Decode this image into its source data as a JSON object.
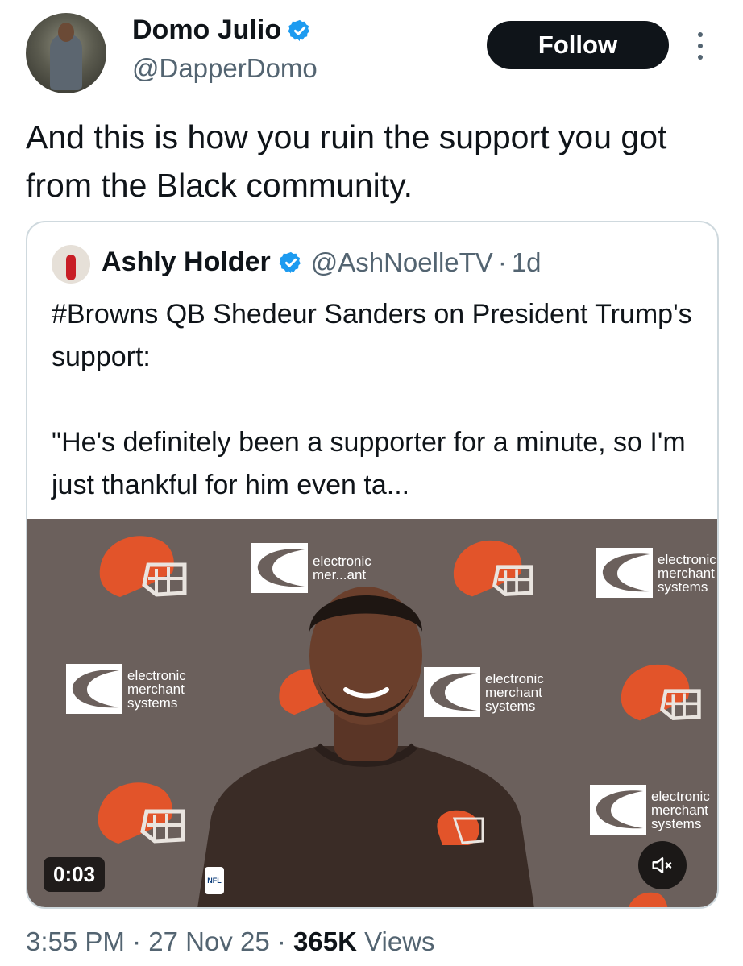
{
  "author": {
    "display_name": "Domo Julio",
    "handle": "@DapperDomo",
    "verified_icon": "verified-badge-icon",
    "avatar_icon": "user-avatar"
  },
  "follow_button": {
    "label": "Follow"
  },
  "more_icon": "more-options-icon",
  "tweet": {
    "text": "And this is how you ruin the support you got from the Black community."
  },
  "quoted_tweet": {
    "display_name": "Ashly Holder",
    "handle": "@AshNoelleTV",
    "separator": "·",
    "age": "1d",
    "text": "#Browns QB Shedeur Sanders on President Trump's support:\n\n\"He's definitely been a supporter for a minute, so I'm just thankful for him even ta...",
    "video": {
      "timestamp": "0:03",
      "mute_icon": "muted-speaker-icon",
      "backdrop_text": [
        "electronic",
        "merchant",
        "systems"
      ],
      "sponsor_partial_text": [
        "electronic",
        "mer...ant"
      ],
      "nfl_text": "NFL"
    }
  },
  "meta": {
    "time": "3:55 PM",
    "sep1": "·",
    "date": "27 Nov 25",
    "sep2": "·",
    "views_count": "365K",
    "views_label": "Views"
  },
  "colors": {
    "text_primary": "#0f1419",
    "text_secondary": "#536471",
    "verified_blue": "#1d9bf0",
    "browns_orange": "#e2542a",
    "border": "#cfd9de"
  }
}
